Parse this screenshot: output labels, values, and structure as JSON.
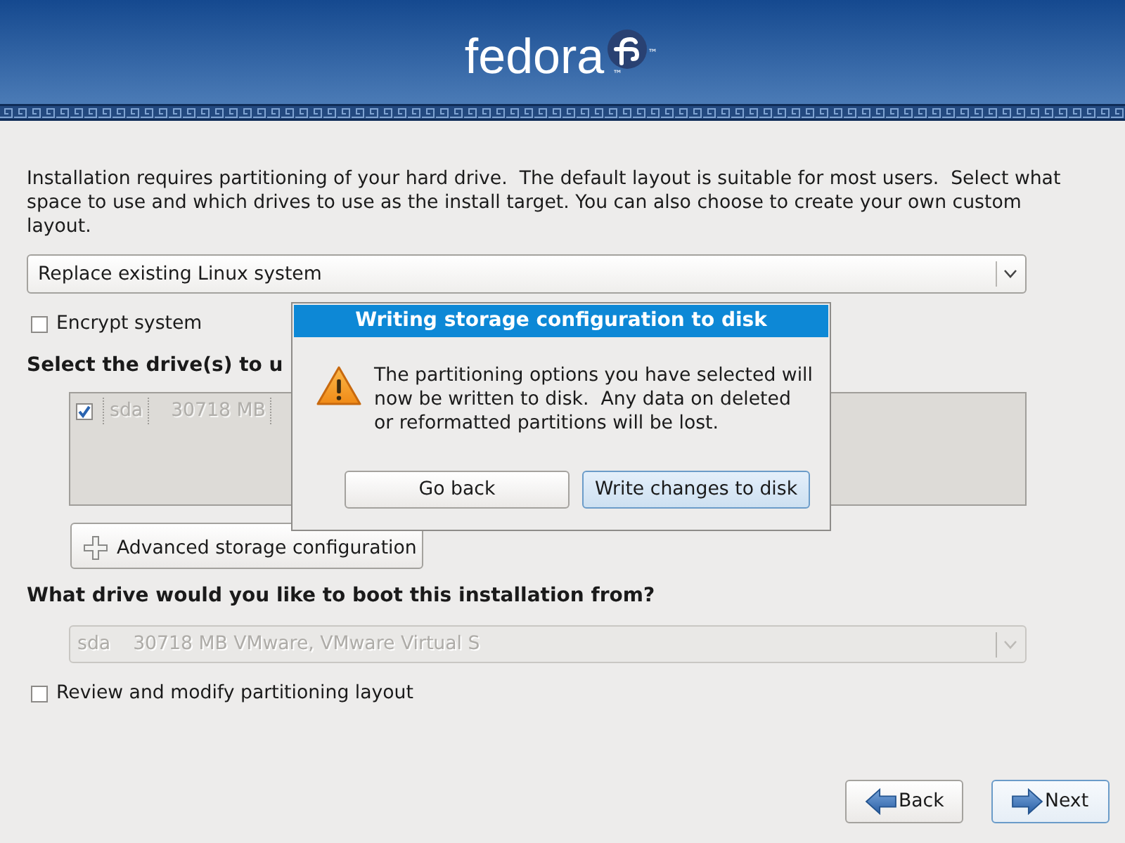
{
  "header": {
    "logo_text": "fedora",
    "trademarks": [
      "™",
      "™"
    ]
  },
  "intro": "Installation requires partitioning of your hard drive.  The default layout is suitable for most users.  Select what space to use and which drives to use as the install target. You can also choose to create your own custom layout.",
  "layout_choice": {
    "value": "Replace existing Linux system",
    "disabled": false
  },
  "encrypt": {
    "label": "Encrypt system",
    "checked": false
  },
  "drives_heading": "Select the drive(s) to u",
  "drive_list": {
    "disabled": true,
    "rows": [
      {
        "checked": true,
        "name": "sda",
        "size": "30718 MB"
      }
    ]
  },
  "advanced_button": "Advanced storage configuration",
  "boot_heading": "What drive would you like to boot this installation from?",
  "boot_drive": {
    "name": "sda",
    "details": "30718 MB VMware, VMware Virtual S",
    "disabled": true
  },
  "review": {
    "label": "Review and modify partitioning layout",
    "checked": false
  },
  "nav_buttons": [
    {
      "kind": "back",
      "label": "Back",
      "focused": false
    },
    {
      "kind": "next",
      "label": "Next",
      "focused": true
    }
  ],
  "dialog": {
    "title": "Writing storage configuration to disk",
    "message": "The partitioning options you have selected will now be written to disk.  Any data on deleted or reformatted partitions will be lost.",
    "buttons": [
      {
        "label": "Go back",
        "focused": false
      },
      {
        "label": "Write changes to disk",
        "focused": true
      }
    ]
  }
}
